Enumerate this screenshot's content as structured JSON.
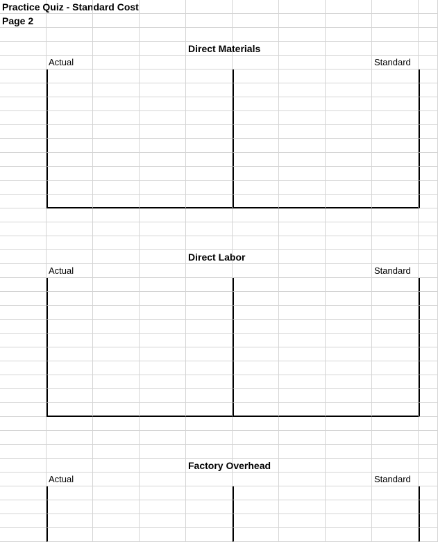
{
  "header": {
    "title": "Practice Quiz - Standard Cost",
    "page": "Page 2"
  },
  "sections": {
    "materials": {
      "title": "Direct Materials",
      "left_label": "Actual",
      "right_label": "Standard"
    },
    "labor": {
      "title": "Direct Labor",
      "left_label": "Actual",
      "right_label": "Standard"
    },
    "overhead": {
      "title": "Factory Overhead",
      "left_label": "Actual",
      "right_label": "Standard"
    }
  }
}
